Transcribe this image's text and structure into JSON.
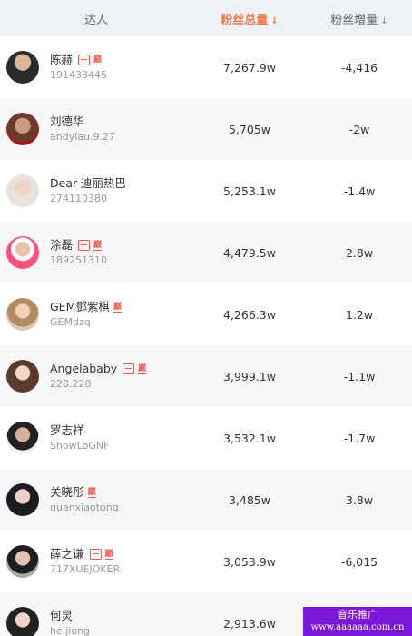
{
  "header": {
    "user_label": "达人",
    "total_label": "粉丝总量",
    "growth_label": "粉丝增量",
    "sort_glyph": "↓"
  },
  "rows": [
    {
      "name": "陈赫",
      "id": "191433445",
      "total": "7,267.9w",
      "growth": "-4,416",
      "badges": true
    },
    {
      "name": "刘德华",
      "id": "andylau.9.27",
      "total": "5,705w",
      "growth": "-2w",
      "badges": false
    },
    {
      "name": "Dear-迪丽热巴",
      "id": "274110380",
      "total": "5,253.1w",
      "growth": "-1.4w",
      "badges": false
    },
    {
      "name": "涂磊",
      "id": "189251310",
      "total": "4,479.5w",
      "growth": "2.8w",
      "badges": true
    },
    {
      "name": "GEM鄧紫棋",
      "id": "GEMdzq",
      "total": "4,266.3w",
      "growth": "1.2w",
      "badges": "text-only"
    },
    {
      "name": "Angelababy",
      "id": "228.228",
      "total": "3,999.1w",
      "growth": "-1.1w",
      "badges": true
    },
    {
      "name": "罗志祥",
      "id": "ShowLoGNF",
      "total": "3,532.1w",
      "growth": "-1.7w",
      "badges": false
    },
    {
      "name": "关晓彤",
      "id": "guanxiaotong",
      "total": "3,485w",
      "growth": "3.8w",
      "badges": "text-only"
    },
    {
      "name": "薛之谦",
      "id": "717XUEJOKER",
      "total": "3,053.9w",
      "growth": "-6,015",
      "badges": true
    },
    {
      "name": "何炅",
      "id": "he.jiong",
      "total": "2,913.6w",
      "growth": "",
      "badges": false
    }
  ],
  "badge_text": "巅",
  "watermark": {
    "title": "音乐推广",
    "url": "www.aaaaaa.com.cn"
  },
  "colors": {
    "accent": "#f2784b",
    "badge": "#f2564b",
    "header_bg": "#eef1f6",
    "watermark_bg": "#7a17d9"
  },
  "icons": {
    "weibo_badge": "weibo-badge-icon",
    "sort": "sort-down-icon"
  }
}
